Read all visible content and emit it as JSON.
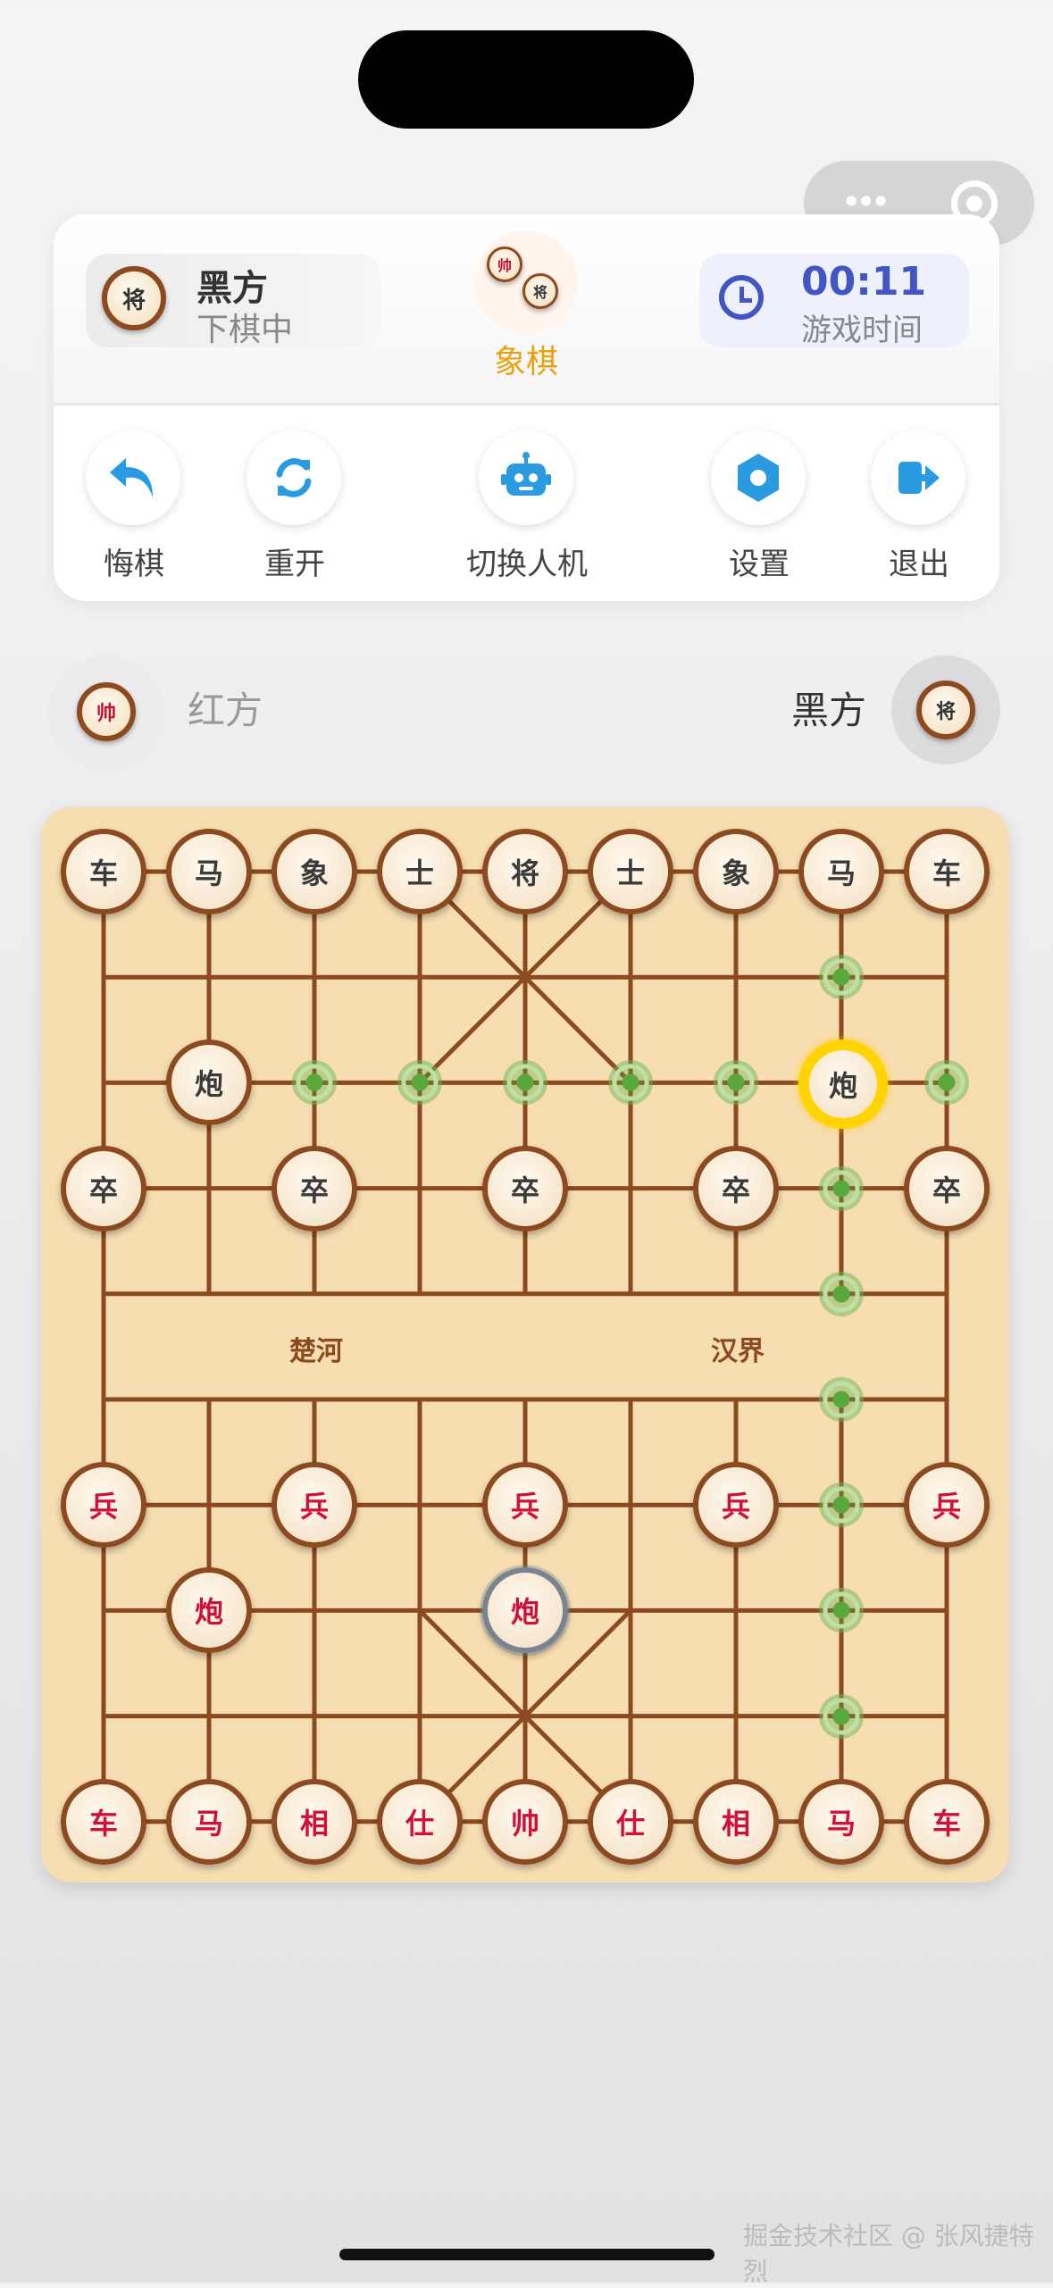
{
  "header": {
    "turn_piece": "将",
    "turn_player": "黑方",
    "turn_status": "下棋中",
    "logo_pieces": [
      "帅",
      "将"
    ],
    "app_name": "象棋",
    "timer": "00:11",
    "timer_label": "游戏时间"
  },
  "actions": [
    {
      "label": "悔棋",
      "icon": "undo-icon"
    },
    {
      "label": "重开",
      "icon": "restart-icon"
    },
    {
      "label": "切换人机",
      "icon": "robot-icon"
    },
    {
      "label": "设置",
      "icon": "gear-icon"
    },
    {
      "label": "退出",
      "icon": "exit-icon"
    }
  ],
  "players": {
    "red": {
      "name": "红方",
      "piece": "帅"
    },
    "black": {
      "name": "黑方",
      "piece": "将"
    }
  },
  "board": {
    "river_left": "楚河",
    "river_right": "汉界",
    "selected": {
      "col": 7,
      "row": 2
    },
    "last_moved": {
      "col": 4,
      "row": 7
    },
    "pieces": [
      {
        "char": "车",
        "side": "black",
        "col": 0,
        "row": 0
      },
      {
        "char": "马",
        "side": "black",
        "col": 1,
        "row": 0
      },
      {
        "char": "象",
        "side": "black",
        "col": 2,
        "row": 0
      },
      {
        "char": "士",
        "side": "black",
        "col": 3,
        "row": 0
      },
      {
        "char": "将",
        "side": "black",
        "col": 4,
        "row": 0
      },
      {
        "char": "士",
        "side": "black",
        "col": 5,
        "row": 0
      },
      {
        "char": "象",
        "side": "black",
        "col": 6,
        "row": 0
      },
      {
        "char": "马",
        "side": "black",
        "col": 7,
        "row": 0
      },
      {
        "char": "车",
        "side": "black",
        "col": 8,
        "row": 0
      },
      {
        "char": "炮",
        "side": "black",
        "col": 1,
        "row": 2
      },
      {
        "char": "炮",
        "side": "black",
        "col": 7,
        "row": 2
      },
      {
        "char": "卒",
        "side": "black",
        "col": 0,
        "row": 3
      },
      {
        "char": "卒",
        "side": "black",
        "col": 2,
        "row": 3
      },
      {
        "char": "卒",
        "side": "black",
        "col": 4,
        "row": 3
      },
      {
        "char": "卒",
        "side": "black",
        "col": 6,
        "row": 3
      },
      {
        "char": "卒",
        "side": "black",
        "col": 8,
        "row": 3
      },
      {
        "char": "兵",
        "side": "red",
        "col": 0,
        "row": 6
      },
      {
        "char": "兵",
        "side": "red",
        "col": 2,
        "row": 6
      },
      {
        "char": "兵",
        "side": "red",
        "col": 4,
        "row": 6
      },
      {
        "char": "兵",
        "side": "red",
        "col": 6,
        "row": 6
      },
      {
        "char": "兵",
        "side": "red",
        "col": 8,
        "row": 6
      },
      {
        "char": "炮",
        "side": "red",
        "col": 1,
        "row": 7
      },
      {
        "char": "炮",
        "side": "red",
        "col": 4,
        "row": 7
      },
      {
        "char": "车",
        "side": "red",
        "col": 0,
        "row": 9
      },
      {
        "char": "马",
        "side": "red",
        "col": 1,
        "row": 9
      },
      {
        "char": "相",
        "side": "red",
        "col": 2,
        "row": 9
      },
      {
        "char": "仕",
        "side": "red",
        "col": 3,
        "row": 9
      },
      {
        "char": "帅",
        "side": "red",
        "col": 4,
        "row": 9
      },
      {
        "char": "仕",
        "side": "red",
        "col": 5,
        "row": 9
      },
      {
        "char": "相",
        "side": "red",
        "col": 6,
        "row": 9
      },
      {
        "char": "马",
        "side": "red",
        "col": 7,
        "row": 9
      },
      {
        "char": "车",
        "side": "red",
        "col": 8,
        "row": 9
      }
    ],
    "move_hints": [
      {
        "col": 7,
        "row": 1
      },
      {
        "col": 2,
        "row": 2
      },
      {
        "col": 3,
        "row": 2
      },
      {
        "col": 4,
        "row": 2
      },
      {
        "col": 5,
        "row": 2
      },
      {
        "col": 6,
        "row": 2
      },
      {
        "col": 8,
        "row": 2
      },
      {
        "col": 7,
        "row": 3
      },
      {
        "col": 7,
        "row": 4
      },
      {
        "col": 7,
        "row": 5
      },
      {
        "col": 7,
        "row": 6
      },
      {
        "col": 7,
        "row": 7
      },
      {
        "col": 7,
        "row": 8
      }
    ]
  },
  "watermark": "掘金技术社区 @ 张风捷特烈",
  "colors": {
    "accent": "#e8a20e",
    "timer": "#4255c2",
    "action_icon": "#2a9be0",
    "red_piece": "#d0103a",
    "board": "#f7deb2",
    "line": "#8b4a1f",
    "hint": "#58a83c",
    "selected": "#ffd400"
  }
}
